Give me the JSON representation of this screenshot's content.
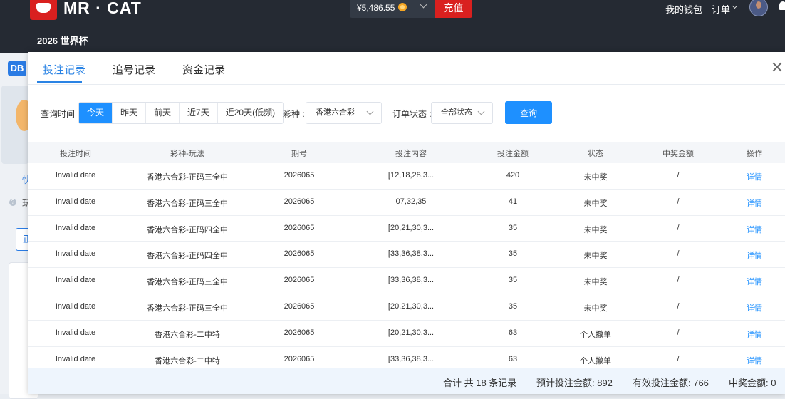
{
  "header": {
    "brand": "MR · CAT",
    "balance": "¥5,486.55",
    "recharge_label": "充值",
    "wallet_label": "我的钱包",
    "orders_label": "订单",
    "subnav_label": "2026 世界杯"
  },
  "background": {
    "db_badge": "DB",
    "quick_label": "快",
    "help_mark": "?",
    "play_label": "玩",
    "tab_label": "正"
  },
  "modal": {
    "tabs": [
      {
        "label": "投注记录",
        "active": true
      },
      {
        "label": "追号记录",
        "active": false
      },
      {
        "label": "资金记录",
        "active": false
      }
    ],
    "filters": {
      "time_label": "查询时间 :",
      "time_options": [
        "今天",
        "昨天",
        "前天",
        "近7天",
        "近20天(低频)"
      ],
      "time_selected": "今天",
      "lottery_label": "彩种 :",
      "lottery_value": "香港六合彩",
      "status_label": "订单状态 :",
      "status_value": "全部状态",
      "query_label": "查询"
    },
    "table": {
      "headers": [
        "投注时间",
        "彩种-玩法",
        "期号",
        "投注内容",
        "投注金额",
        "状态",
        "中奖金额",
        "操作"
      ],
      "rows": [
        [
          "Invalid date",
          "香港六合彩-正码三全中",
          "2026065",
          "[12,18,28,3...",
          "420",
          "未中奖",
          "/",
          "详情"
        ],
        [
          "Invalid date",
          "香港六合彩-正码三全中",
          "2026065",
          "07,32,35",
          "41",
          "未中奖",
          "/",
          "详情"
        ],
        [
          "Invalid date",
          "香港六合彩-正码四全中",
          "2026065",
          "[20,21,30,3...",
          "35",
          "未中奖",
          "/",
          "详情"
        ],
        [
          "Invalid date",
          "香港六合彩-正码四全中",
          "2026065",
          "[33,36,38,3...",
          "35",
          "未中奖",
          "/",
          "详情"
        ],
        [
          "Invalid date",
          "香港六合彩-正码三全中",
          "2026065",
          "[33,36,38,3...",
          "35",
          "未中奖",
          "/",
          "详情"
        ],
        [
          "Invalid date",
          "香港六合彩-正码三全中",
          "2026065",
          "[20,21,30,3...",
          "35",
          "未中奖",
          "/",
          "详情"
        ],
        [
          "Invalid date",
          "香港六合彩-二中特",
          "2026065",
          "[20,21,30,3...",
          "63",
          "个人撤单",
          "/",
          "详情"
        ],
        [
          "Invalid date",
          "香港六合彩-二中特",
          "2026065",
          "[33,36,38,3...",
          "63",
          "个人撤单",
          "/",
          "详情"
        ]
      ]
    },
    "summary": {
      "total": "合计 共 18 条记录",
      "expected": "预计投注金额: 892",
      "effective": "有效投注金额: 766",
      "won": "中奖金额: 0"
    }
  },
  "colors": {
    "header_bg": "#252a33",
    "brand_red": "#d9201f",
    "accent_blue": "#1e90ff"
  }
}
